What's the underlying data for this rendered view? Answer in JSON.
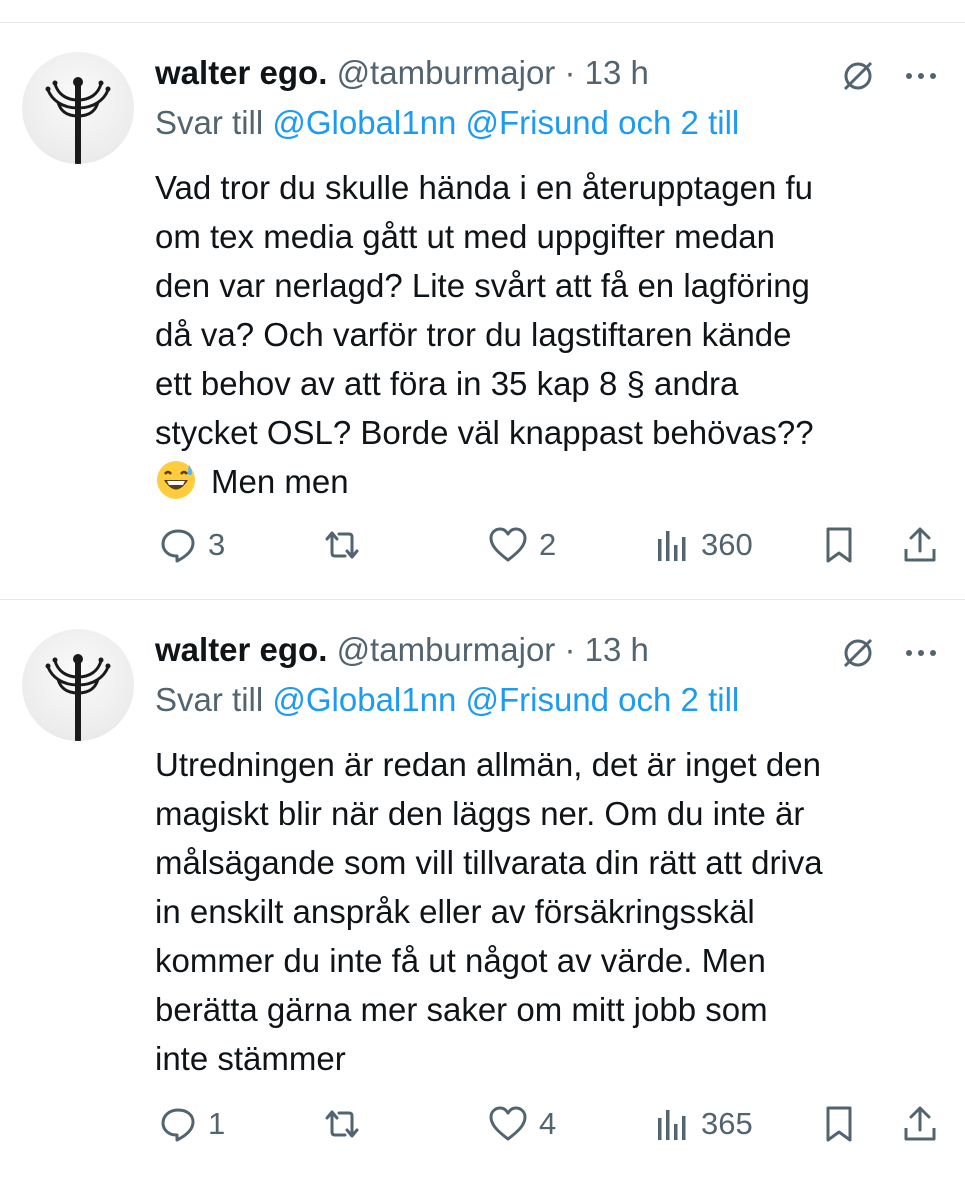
{
  "colors": {
    "accent": "#1d9bf0",
    "secondary_text": "#536471",
    "primary_text": "#0f1419",
    "divider": "#e6e9ec"
  },
  "tweets": [
    {
      "author_name": "walter ego.",
      "handle": "@tamburmajor",
      "separator": "·",
      "time": "13 h",
      "reply_prefix": "Svar till",
      "reply_mentions": "@Global1nn @Frisund och 2 till",
      "body_lines": [
        "Vad tror du skulle hända i en återupptagen fu",
        "om tex media gått ut med uppgifter medan",
        "den var nerlagd? Lite svårt att få en lagföring",
        "då va? Och varför tror du lagstiftaren kände",
        "ett behov av att föra in 35 kap 8 § andra",
        "stycket OSL? Borde väl knappast behövas??",
        "Men men"
      ],
      "emoji": "grinning-face-with-sweat",
      "reply_count": "3",
      "repost_count": "",
      "like_count": "2",
      "view_count": "360"
    },
    {
      "author_name": "walter ego.",
      "handle": "@tamburmajor",
      "separator": "·",
      "time": "13 h",
      "reply_prefix": "Svar till",
      "reply_mentions": "@Global1nn @Frisund och 2 till",
      "body_lines": [
        "Utredningen är redan allmän, det är inget den",
        "magiskt blir när den läggs ner. Om du inte är",
        "målsägande som vill tillvarata din rätt att driva",
        "in enskilt anspråk eller av försäkringsskäl",
        "kommer du inte få ut något av värde. Men",
        "berätta gärna mer saker om mitt jobb som",
        "inte stämmer"
      ],
      "reply_count": "1",
      "repost_count": "",
      "like_count": "4",
      "view_count": "365"
    }
  ],
  "icons": {
    "grok": "grok-icon",
    "more": "more-icon",
    "reply": "reply-icon",
    "repost": "repost-icon",
    "like": "like-icon",
    "views": "views-icon",
    "bookmark": "bookmark-icon",
    "share": "share-icon"
  }
}
